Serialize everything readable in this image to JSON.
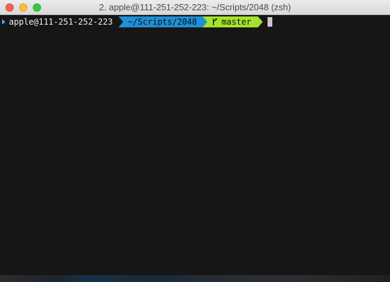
{
  "window": {
    "title": "2. apple@111-251-252-223: ~/Scripts/2048 (zsh)",
    "colors": {
      "titlebar": "#dcdcdc",
      "terminal_bg": "#161616",
      "close": "#fc605c",
      "minimize": "#fdbc40",
      "maximize": "#34c84a"
    }
  },
  "terminal": {
    "prompt": {
      "status_icon": "chevron-right-icon",
      "user_host": "apple@111-251-252-223",
      "path": "~/Scripts/2048",
      "branch_icon": "git-branch-icon",
      "branch": "master",
      "colors": {
        "path_bg": "#1f8fd6",
        "git_bg": "#a5e22e",
        "status_arrow": "#4da3ff"
      }
    },
    "cursor_visible": true
  }
}
